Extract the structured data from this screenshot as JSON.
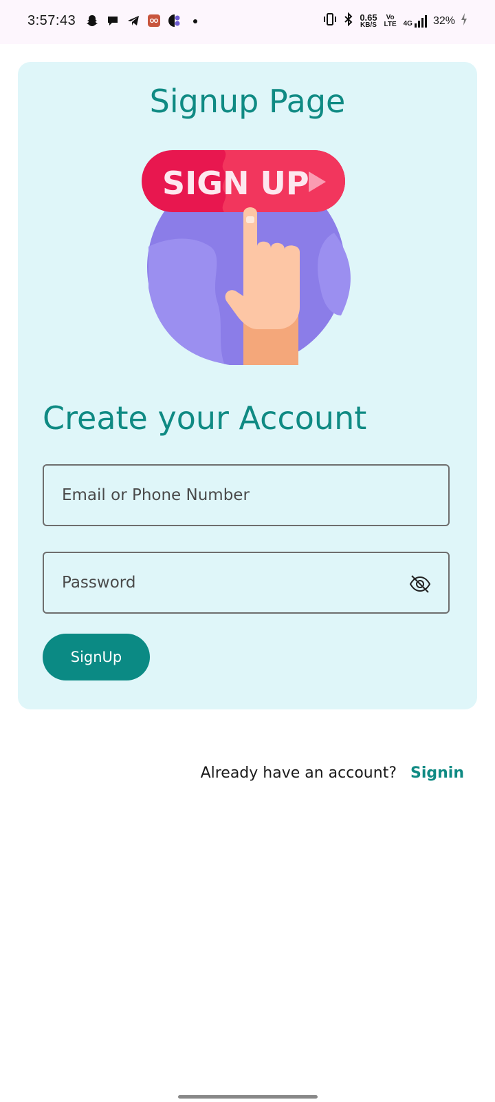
{
  "status_bar": {
    "time": "3:57:43",
    "net_speed_value": "0.65",
    "net_speed_unit": "KB/S",
    "volte": "Vo LTE",
    "network": "4G",
    "battery": "32%"
  },
  "card": {
    "title": "Signup Page",
    "illustration_text": "SIGN UP",
    "subtitle": "Create your Account"
  },
  "form": {
    "email_placeholder": "Email or Phone Number",
    "email_value": "",
    "password_placeholder": "Password",
    "password_value": "",
    "signup_label": "SignUp"
  },
  "footer": {
    "already_text": "Already have an account?",
    "signin_label": "Signin"
  },
  "colors": {
    "accent": "#0f8a83",
    "card_bg": "#dff6f9",
    "button_bg": "#0b8a84"
  },
  "icons": [
    "snapchat-icon",
    "chat-icon",
    "telegram-icon",
    "app-icon",
    "half-circle-icon",
    "vibrate-icon",
    "bluetooth-icon",
    "signal-icon",
    "battery-charging-icon",
    "eye-off-icon"
  ]
}
